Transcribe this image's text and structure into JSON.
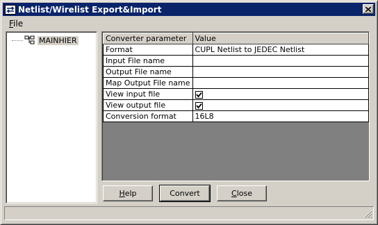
{
  "window": {
    "title": "Netlist/Wirelist Export&Import",
    "app_icon": "swap-arrows-icon",
    "close_icon": "close-icon"
  },
  "menu": {
    "items": [
      {
        "label": "File",
        "mnemonic": "F",
        "rest": "ile"
      }
    ]
  },
  "tree": {
    "root_label": "MAINHIER",
    "icon": "hierarchy-icon"
  },
  "grid": {
    "headers": [
      "Converter parameter",
      "Value"
    ],
    "rows": [
      {
        "param": "Format",
        "value": "CUPL Netlist to JEDEC Netlist",
        "kind": "text"
      },
      {
        "param": "Input File name",
        "value": "",
        "kind": "text"
      },
      {
        "param": "Output File name",
        "value": "",
        "kind": "text"
      },
      {
        "param": "Map Output File name",
        "value": "",
        "kind": "text"
      },
      {
        "param": "View input file",
        "checked": true,
        "kind": "checkbox"
      },
      {
        "param": "View output file",
        "checked": true,
        "kind": "checkbox"
      },
      {
        "param": "Conversion format",
        "value": "16L8",
        "kind": "right"
      }
    ]
  },
  "buttons": {
    "help": {
      "mnemonic": "H",
      "rest": "elp"
    },
    "convert": {
      "label": "Convert"
    },
    "close": {
      "mnemonic": "C",
      "rest": "lose"
    }
  },
  "colors": {
    "titlebar": "#0a246a",
    "face": "#d4d0c8",
    "grid_bg": "#808080"
  }
}
